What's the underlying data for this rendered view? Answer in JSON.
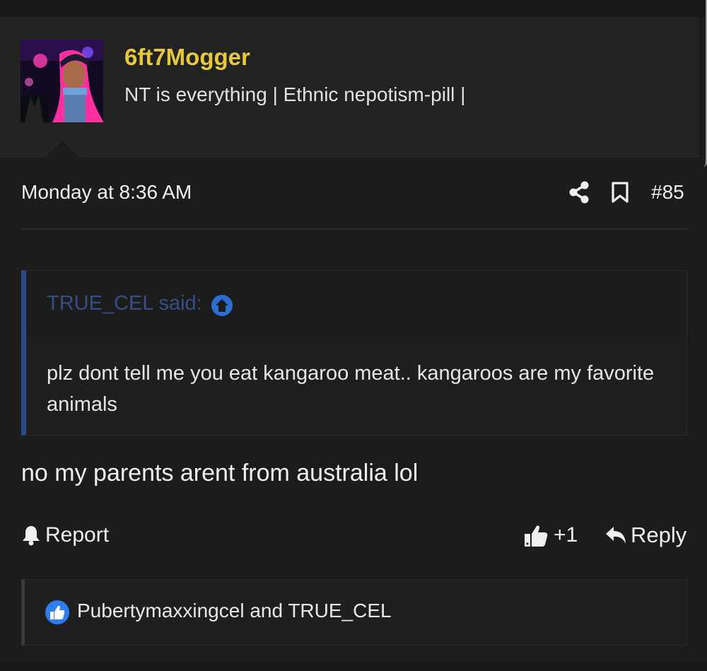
{
  "post": {
    "author": {
      "username": "6ft7Mogger",
      "user_title": "NT is everything | Ethnic nepotism-pill |",
      "avatar_icon": "anime-avatar"
    },
    "date": "Monday at 8:36 AM",
    "post_number": "#85",
    "actions_top": {
      "share_icon": "share-icon",
      "bookmark_icon": "bookmark-icon"
    },
    "quote": {
      "author_label": "TRUE_CEL said:",
      "author_color": "#354f86",
      "text": "plz dont tell me you eat kangaroo meat.. kangaroos are my favorite animals"
    },
    "message": "no my parents arent from australia lol",
    "footer": {
      "report_label": "Report",
      "like_count": "+1",
      "reply_label": "Reply"
    },
    "reactions": {
      "icon": "like-reaction-icon",
      "text": "Pubertymaxxingcel and TRUE_CEL",
      "icon_color": "#2d7ff0"
    }
  },
  "colors": {
    "background": "#1c1c1c",
    "username": "#e8c93b",
    "quote_border": "#2a4a8c"
  }
}
